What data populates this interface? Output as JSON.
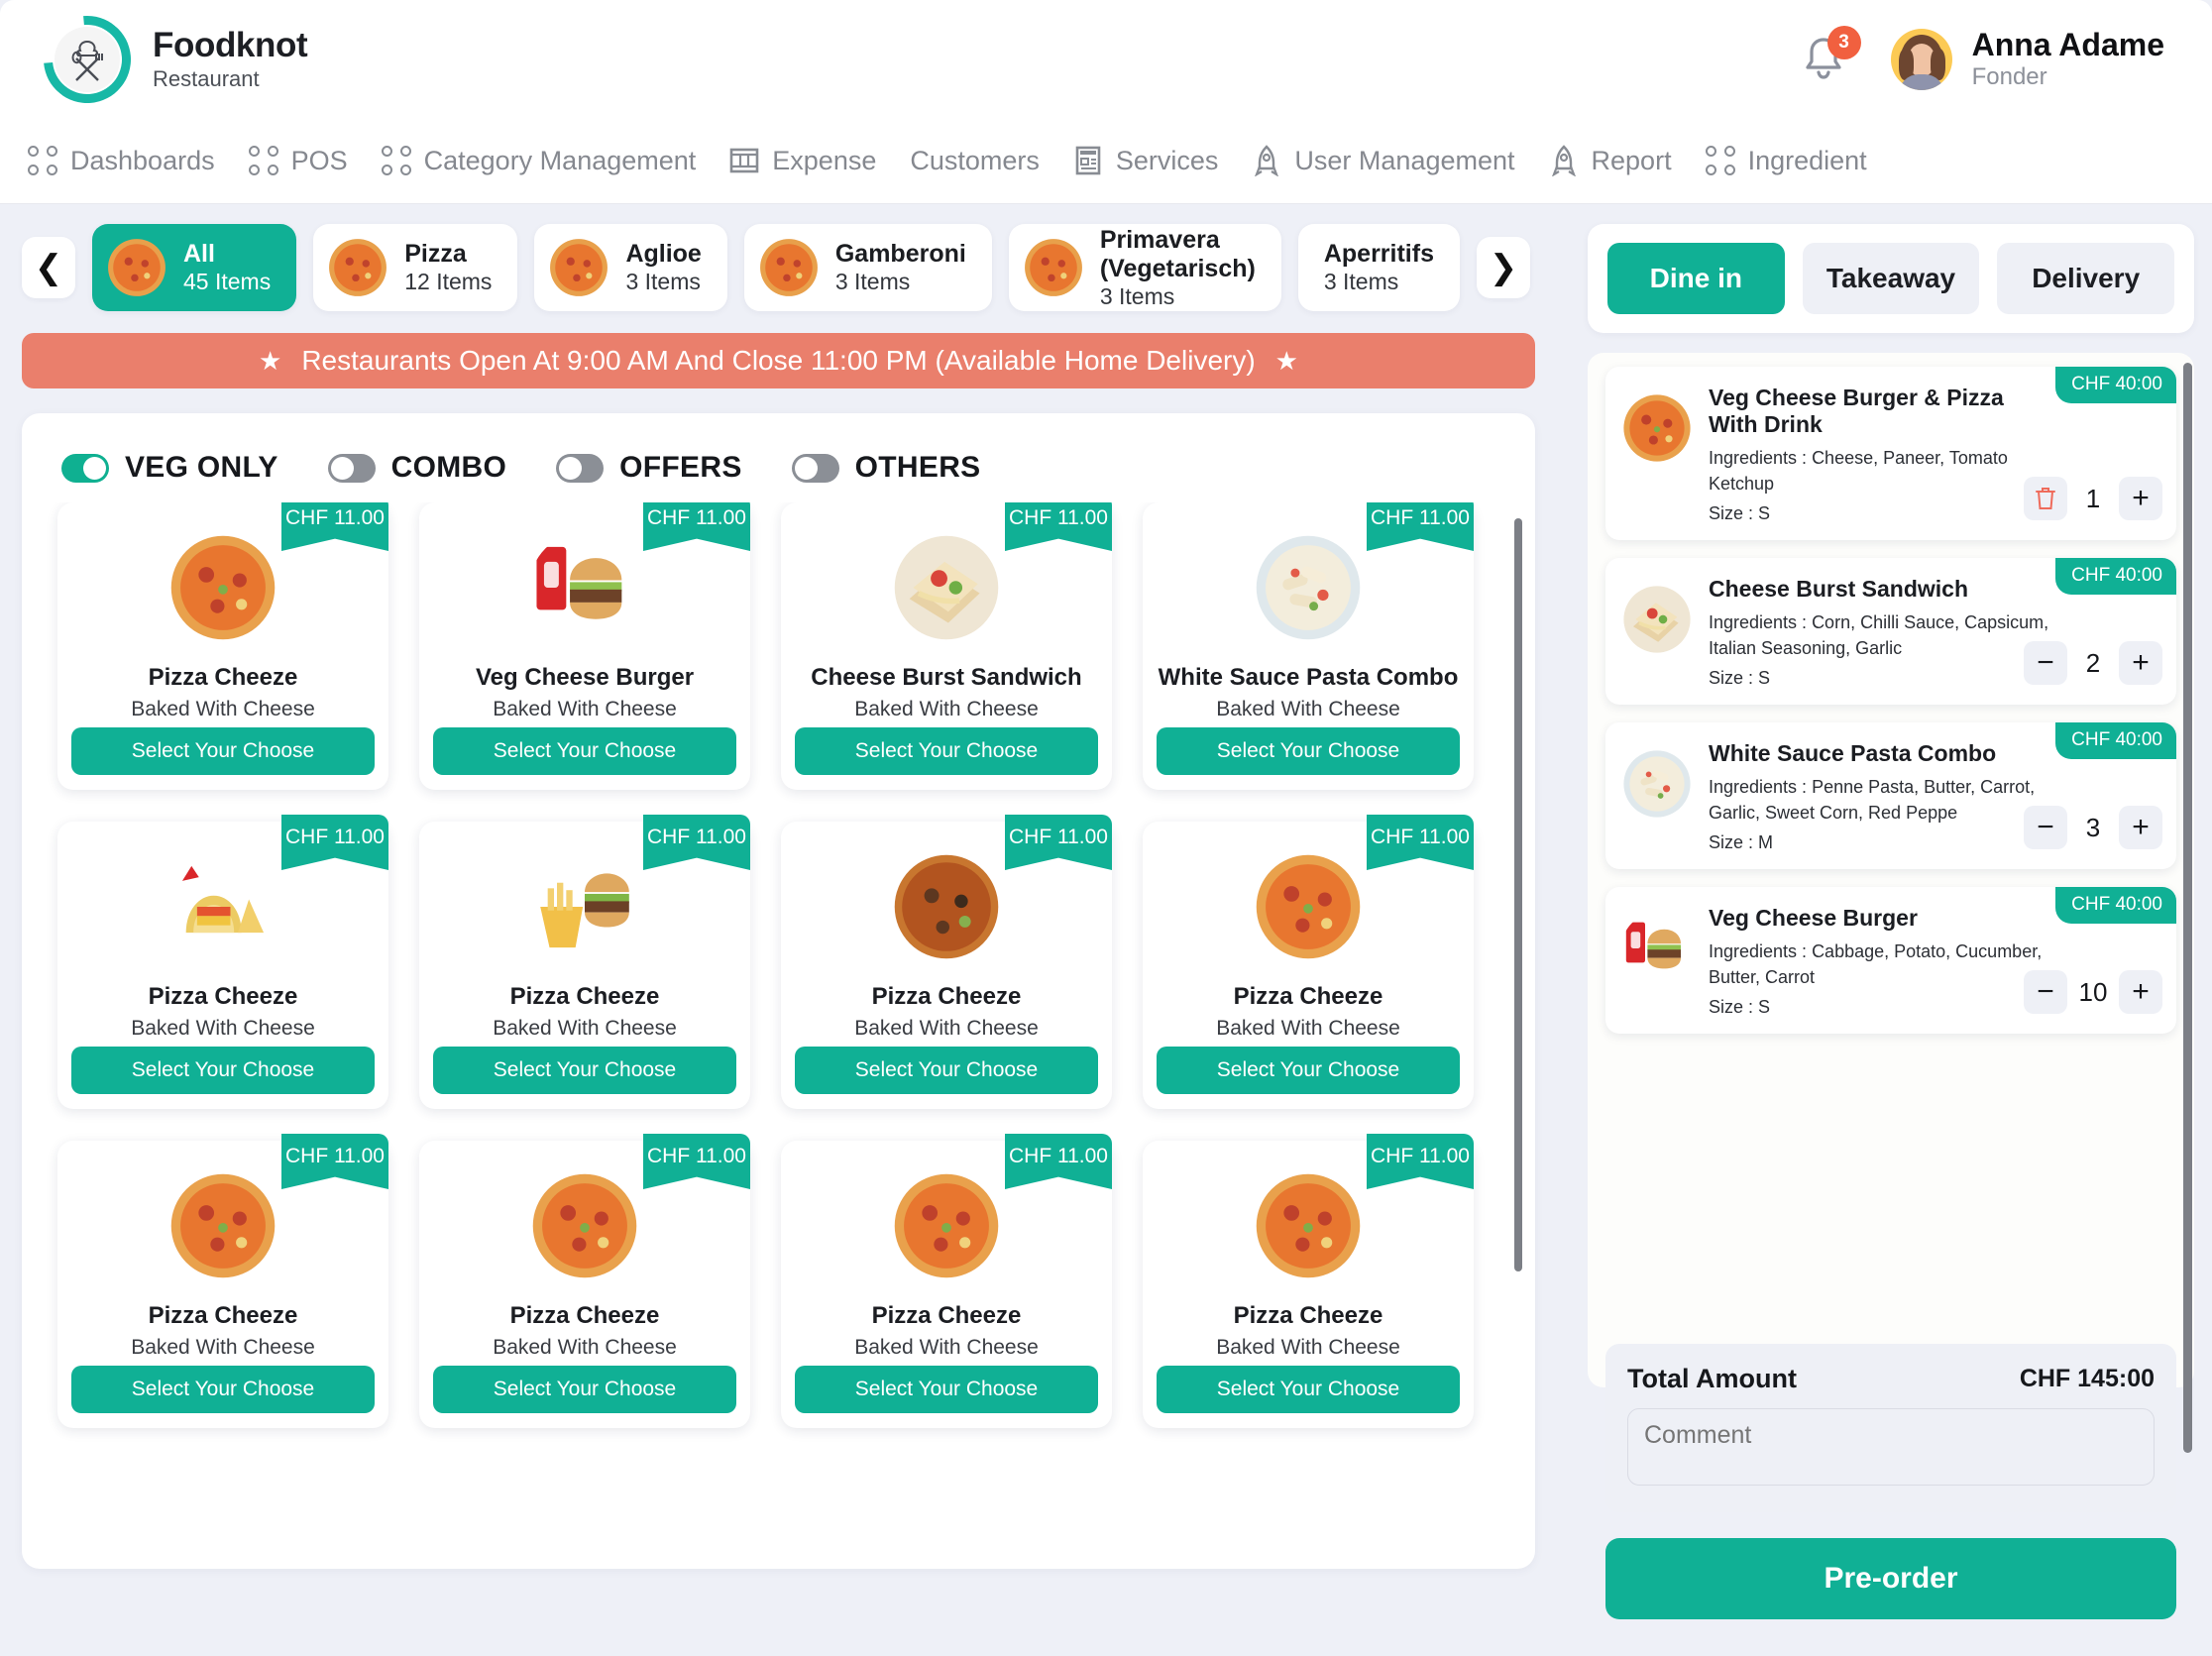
{
  "brand": {
    "title": "Foodknot",
    "subtitle": "Restaurant",
    "logo_icon": "chef-hat-spoon-fork-icon",
    "accent_color": "#10b095"
  },
  "header": {
    "notification_icon": "bell-icon",
    "notification_count": "3",
    "user_name": "Anna Adame",
    "user_role": "Fonder"
  },
  "nav": {
    "items": [
      {
        "label": "Dashboards",
        "icon": "grid-dots-icon"
      },
      {
        "label": "POS",
        "icon": "grid-dots-icon"
      },
      {
        "label": "Category Management",
        "icon": "grid-dots-icon"
      },
      {
        "label": "Expense",
        "icon": "table-columns-icon"
      },
      {
        "label": "Customers",
        "icon": "none"
      },
      {
        "label": "Services",
        "icon": "id-card-icon"
      },
      {
        "label": "User Management",
        "icon": "rocket-icon"
      },
      {
        "label": "Report",
        "icon": "rocket-icon"
      },
      {
        "label": "Ingredient",
        "icon": "grid-dots-icon"
      }
    ]
  },
  "categories": {
    "prev_icon": "chevron-left-icon",
    "next_icon": "chevron-right-icon",
    "items": [
      {
        "name": "All",
        "count": "45 Items",
        "active": true,
        "image": "pizza-thumb"
      },
      {
        "name": "Pizza",
        "count": "12 Items",
        "active": false,
        "image": "pizza-thumb"
      },
      {
        "name": "Aglioe",
        "count": "3 Items",
        "active": false,
        "image": "pizza-thumb"
      },
      {
        "name": "Gamberoni",
        "count": "3 Items",
        "active": false,
        "image": "pizza-thumb"
      },
      {
        "name": "Primavera\n(Vegetarisch)",
        "count": "3 Items",
        "active": false,
        "image": "pizza-thumb"
      },
      {
        "name": "Aperritifs",
        "count": "3 Items",
        "active": false,
        "image": "none"
      }
    ]
  },
  "banner": {
    "text": "Restaurants Open At 9:00 AM And Close 11:00 PM (Available Home Delivery)",
    "left_icon": "star-icon",
    "right_icon": "star-icon",
    "color": "#ea7f6c"
  },
  "filters": [
    {
      "label": "VEG ONLY",
      "on": true
    },
    {
      "label": "COMBO",
      "on": false
    },
    {
      "label": "OFFERS",
      "on": false
    },
    {
      "label": "OTHERS",
      "on": false
    }
  ],
  "products": {
    "button_label": "Select Your Choose",
    "items": [
      {
        "name": "Pizza Cheeze",
        "desc": "Baked With Cheese",
        "price": "CHF 11.00",
        "image": "pizza"
      },
      {
        "name": "Veg Cheese Burger",
        "desc": "Baked With Cheese",
        "price": "CHF 11.00",
        "image": "burger-cola"
      },
      {
        "name": "Cheese Burst Sandwich",
        "desc": "Baked With Cheese",
        "price": "CHF 11.00",
        "image": "sandwich"
      },
      {
        "name": "White Sauce Pasta Combo",
        "desc": "Baked With Cheese",
        "price": "CHF 11.00",
        "image": "pasta"
      },
      {
        "name": "Pizza Cheeze",
        "desc": "Baked With Cheese",
        "price": "CHF 11.00",
        "image": "tacos"
      },
      {
        "name": "Pizza Cheeze",
        "desc": "Baked With Cheese",
        "price": "CHF 11.00",
        "image": "burger-fries"
      },
      {
        "name": "Pizza Cheeze",
        "desc": "Baked With Cheese",
        "price": "CHF 11.00",
        "image": "pizza-dark"
      },
      {
        "name": "Pizza Cheeze",
        "desc": "Baked With Cheese",
        "price": "CHF 11.00",
        "image": "pizza"
      },
      {
        "name": "Pizza Cheeze",
        "desc": "Baked With Cheese",
        "price": "CHF 11.00",
        "image": "pizza"
      },
      {
        "name": "Pizza Cheeze",
        "desc": "Baked With Cheese",
        "price": "CHF 11.00",
        "image": "pizza"
      },
      {
        "name": "Pizza Cheeze",
        "desc": "Baked With Cheese",
        "price": "CHF 11.00",
        "image": "pizza"
      },
      {
        "name": "Pizza Cheeze",
        "desc": "Baked With Cheese",
        "price": "CHF 11.00",
        "image": "pizza"
      }
    ]
  },
  "order": {
    "modes": [
      {
        "label": "Dine in",
        "active": true
      },
      {
        "label": "Takeaway",
        "active": false
      },
      {
        "label": "Delivery",
        "active": false
      }
    ],
    "items": [
      {
        "name": "Veg Cheese Burger & Pizza With Drink",
        "ingredients": "Ingredients : Cheese, Paneer, Tomato Ketchup",
        "size": "Size : S",
        "price": "CHF 40:00",
        "qty": "1",
        "image": "pizza",
        "decrement_icon": "trash-icon",
        "increment_icon": "plus-icon"
      },
      {
        "name": "Cheese Burst Sandwich",
        "ingredients": "Ingredients : Corn, Chilli Sauce, Capsicum, Italian Seasoning, Garlic",
        "size": "Size : S",
        "price": "CHF 40:00",
        "qty": "2",
        "image": "sandwich",
        "decrement_icon": "minus-icon",
        "increment_icon": "plus-icon"
      },
      {
        "name": "White Sauce Pasta Combo",
        "ingredients": "Ingredients : Penne Pasta, Butter, Carrot, Garlic, Sweet Corn, Red Peppe",
        "size": "Size : M",
        "price": "CHF 40:00",
        "qty": "3",
        "image": "pasta",
        "decrement_icon": "minus-icon",
        "increment_icon": "plus-icon"
      },
      {
        "name": "Veg Cheese Burger",
        "ingredients": "Ingredients : Cabbage, Potato, Cucumber, Butter, Carrot",
        "size": "Size : S",
        "price": "CHF 40:00",
        "qty": "10",
        "image": "burger-cola",
        "decrement_icon": "minus-icon",
        "increment_icon": "plus-icon"
      }
    ],
    "total_label": "Total Amount",
    "total_value": "CHF 145:00",
    "comment_placeholder": "Comment",
    "submit_label": "Pre-order"
  }
}
